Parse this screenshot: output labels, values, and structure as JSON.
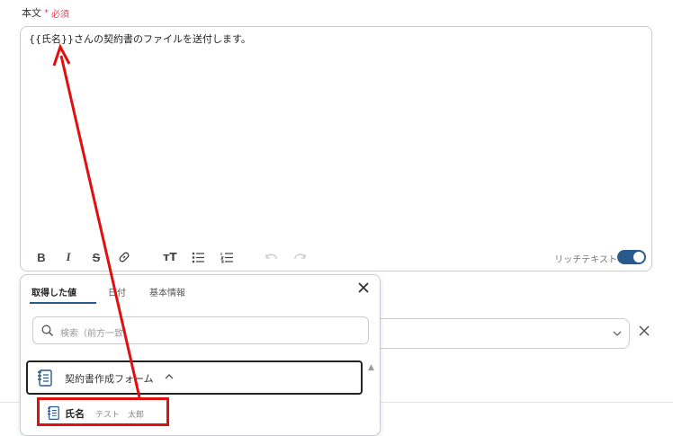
{
  "field": {
    "label": "本文",
    "required_mark": "*",
    "required_text": "必須",
    "body_text": "{{氏名}}さんの契約書のファイルを送付します。"
  },
  "toolbar": {
    "buttons": [
      "bold-icon",
      "italic-icon",
      "strikethrough-icon",
      "link-icon",
      "text-size-icon",
      "bulleted-list-icon",
      "numbered-list-icon",
      "undo-icon",
      "redo-icon"
    ],
    "rich_text_label": "リッチテキスト",
    "rich_text_enabled": true
  },
  "popup": {
    "tabs": [
      "取得した値",
      "日付",
      "基本情報"
    ],
    "active_tab": "取得した値",
    "search_placeholder": "検索（前方一致）",
    "group_label": "契約書作成フォーム",
    "group_expanded": true,
    "item": {
      "name": "氏名",
      "sample": "テスト　太郎"
    }
  },
  "colors": {
    "accent": "#2a5a8c",
    "required": "#e0445a",
    "annotation": "#e01010"
  }
}
